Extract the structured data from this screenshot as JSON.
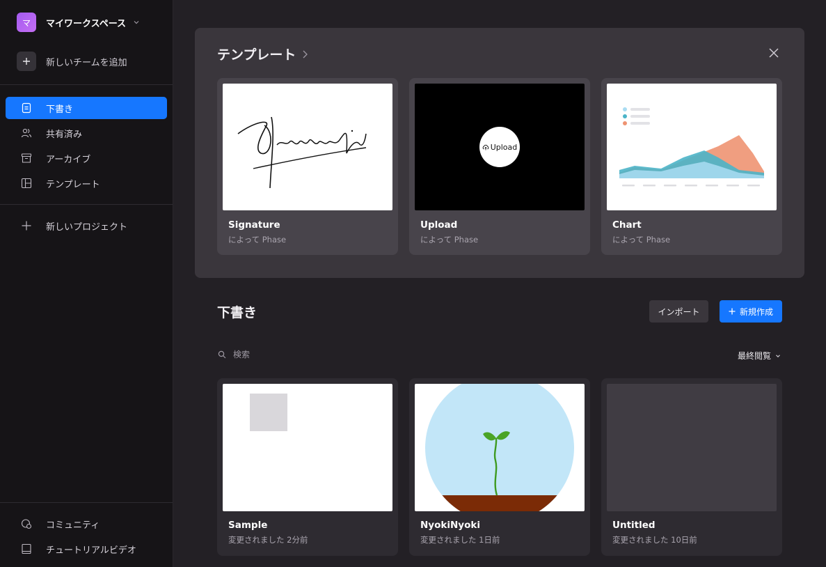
{
  "workspace": {
    "initial": "マ",
    "name": "マイワークスペース"
  },
  "sidebar": {
    "add_team": "新しいチームを追加",
    "nav": [
      {
        "label": "下書き",
        "icon": "file-icon",
        "active": true
      },
      {
        "label": "共有済み",
        "icon": "users-icon",
        "active": false
      },
      {
        "label": "アーカイブ",
        "icon": "archive-icon",
        "active": false
      },
      {
        "label": "テンプレート",
        "icon": "layout-icon",
        "active": false
      }
    ],
    "new_project": "新しいプロジェクト",
    "bottom": [
      {
        "label": "コミュニティ",
        "icon": "community-icon"
      },
      {
        "label": "チュートリアルビデオ",
        "icon": "video-icon"
      }
    ]
  },
  "templates": {
    "title": "テンプレート",
    "cards": [
      {
        "title": "Signature",
        "subtitle": "によって Phase",
        "thumb_text": "Herawati"
      },
      {
        "title": "Upload",
        "subtitle": "によって Phase",
        "thumb_text": "Upload"
      },
      {
        "title": "Chart",
        "subtitle": "によって Phase"
      }
    ]
  },
  "drafts": {
    "title": "下書き",
    "import_label": "インポート",
    "new_label": "新規作成",
    "search_placeholder": "検索",
    "sort_label": "最終閲覧",
    "cards": [
      {
        "title": "Sample",
        "subtitle": "変更されました 2分前"
      },
      {
        "title": "NyokiNyoki",
        "subtitle": "変更されました 1日前"
      },
      {
        "title": "Untitled",
        "subtitle": "変更されました 10日前"
      }
    ]
  },
  "colors": {
    "accent": "#1677ff",
    "workspace_badge": "#b464f2"
  }
}
